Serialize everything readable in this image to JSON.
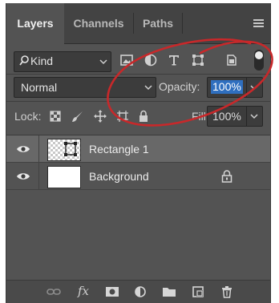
{
  "tabs": [
    {
      "label": "Layers",
      "active": true
    },
    {
      "label": "Channels",
      "active": false
    },
    {
      "label": "Paths",
      "active": false
    }
  ],
  "filter": {
    "kind_label": "Kind",
    "icons": [
      "image-filter-icon",
      "adjustment-filter-icon",
      "type-filter-icon",
      "shape-filter-icon",
      "smart-object-filter-icon"
    ],
    "toggle_on": true
  },
  "blend": {
    "mode": "Normal",
    "opacity_label": "Opacity:",
    "opacity_value": "100%"
  },
  "lock": {
    "label": "Lock:",
    "icons": [
      "lock-transparent-pixels-icon",
      "lock-image-pixels-icon",
      "lock-position-icon",
      "lock-artboard-icon",
      "lock-all-icon"
    ],
    "fill_label": "Fill:",
    "fill_value": "100%"
  },
  "layers": [
    {
      "name": "Rectangle 1",
      "visible": true,
      "selected": true,
      "locked": false
    },
    {
      "name": "Background",
      "visible": true,
      "selected": false,
      "locked": true
    }
  ],
  "footer_icons": [
    "link-layers-icon",
    "fx-icon",
    "add-mask-icon",
    "adjustment-layer-icon",
    "new-group-icon",
    "new-layer-icon",
    "delete-icon"
  ],
  "colors": {
    "panel_bg": "#535353",
    "selection": "#2f6fbf",
    "annotation": "#c8282a"
  }
}
